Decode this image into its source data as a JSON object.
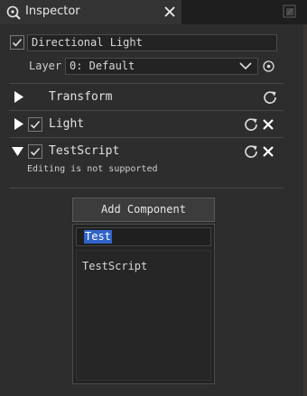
{
  "window": {
    "tab_title": "Inspector",
    "tab_icon": "search-icon",
    "close_icon": "close-icon",
    "control_icon": "restore-icon"
  },
  "object": {
    "active": true,
    "name": "Directional Light",
    "layer_label": "Layer",
    "layer_value": "0: Default"
  },
  "components": [
    {
      "label": "Transform",
      "expanded": false,
      "has_checkbox": false,
      "removable": false
    },
    {
      "label": "Light",
      "expanded": false,
      "has_checkbox": true,
      "enabled": true,
      "removable": true
    },
    {
      "label": "TestScript",
      "expanded": true,
      "has_checkbox": true,
      "enabled": true,
      "removable": true,
      "note": "Editing is not supported"
    }
  ],
  "add_component": {
    "label": "Add Component",
    "search_value": "Test",
    "results": [
      "TestScript"
    ]
  },
  "colors": {
    "background": "#2d2d2d",
    "selection": "#3163c8"
  }
}
